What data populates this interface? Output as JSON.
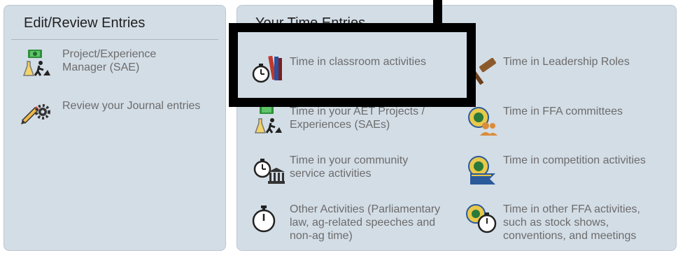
{
  "left_panel": {
    "title": "Edit/Review Entries",
    "items": [
      {
        "label_line1": "Project/Experience",
        "label_line2": "Manager (SAE)",
        "icon": "money-science-worker-icon"
      },
      {
        "label_line1": "Review your Journal entries",
        "icon": "pencil-gear-icon"
      }
    ]
  },
  "right_panel": {
    "title": "Your Time Entries",
    "items": [
      {
        "key": "classroom",
        "lines": [
          "Time in classroom activities"
        ],
        "icon": "stopwatch-books-icon"
      },
      {
        "key": "leadership",
        "lines": [
          "Time in Leadership Roles"
        ],
        "icon": "gavel-icon"
      },
      {
        "key": "aet-projects",
        "lines": [
          "Time in your AET Projects /",
          "Experiences (SAEs)"
        ],
        "icon": "money-science-worker-icon"
      },
      {
        "key": "ffa-committees",
        "lines": [
          "Time in FFA committees"
        ],
        "icon": "ffa-emblem-people-icon"
      },
      {
        "key": "community-service",
        "lines": [
          "Time in your community",
          "service activities"
        ],
        "icon": "stopwatch-building-icon"
      },
      {
        "key": "competition",
        "lines": [
          "Time in competition activities"
        ],
        "icon": "ffa-emblem-ribbon-icon"
      },
      {
        "key": "other-activities",
        "lines": [
          "Other Activities (Parliamentary",
          "law, ag-related speeches and",
          "non-ag time)"
        ],
        "icon": "stopwatch-icon"
      },
      {
        "key": "other-ffa",
        "lines": [
          "Time in other FFA activities,",
          "such as stock shows,",
          "conventions, and meetings"
        ],
        "icon": "ffa-emblem-stopwatch-icon"
      }
    ]
  },
  "colors": {
    "panel_bg": "#d3dde6",
    "text_muted": "#6c6c6c",
    "highlight": "#000000"
  }
}
